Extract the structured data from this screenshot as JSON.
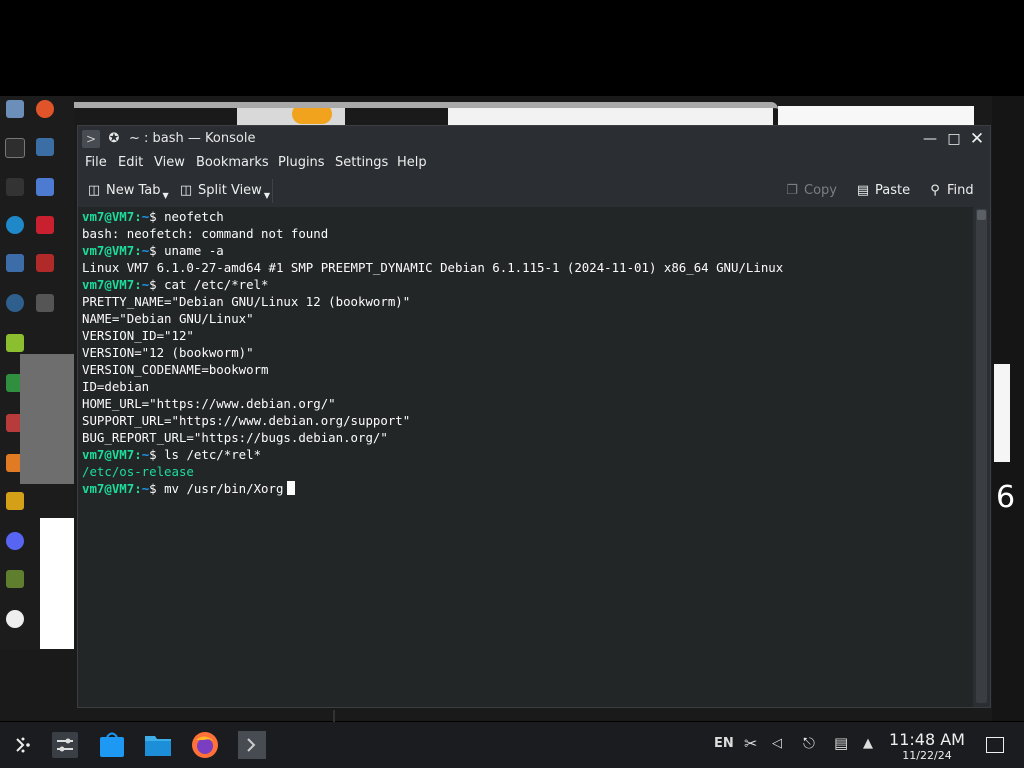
{
  "window": {
    "title": "~ : bash — Konsole",
    "app_icon": "terminal-icon",
    "controls": [
      "minimize",
      "maximize",
      "close"
    ]
  },
  "menu": [
    "File",
    "Edit",
    "View",
    "Bookmarks",
    "Plugins",
    "Settings",
    "Help"
  ],
  "toolbar": {
    "new_tab": "New Tab",
    "split_view": "Split View",
    "copy": "Copy",
    "paste": "Paste",
    "find": "Find"
  },
  "terminal": {
    "prompt_user": "vm7@VM7",
    "prompt_path": "~",
    "prompt_symbol": "$",
    "lines": [
      {
        "type": "cmd",
        "text": "neofetch"
      },
      {
        "type": "out",
        "text": "bash: neofetch: command not found"
      },
      {
        "type": "cmd",
        "text": "uname -a"
      },
      {
        "type": "out",
        "text": "Linux VM7 6.1.0-27-amd64 #1 SMP PREEMPT_DYNAMIC Debian 6.1.115-1 (2024-11-01) x86_64 GNU/Linux"
      },
      {
        "type": "cmd",
        "text": "cat /etc/*rel*"
      },
      {
        "type": "out",
        "text": "PRETTY_NAME=\"Debian GNU/Linux 12 (bookworm)\""
      },
      {
        "type": "out",
        "text": "NAME=\"Debian GNU/Linux\""
      },
      {
        "type": "out",
        "text": "VERSION_ID=\"12\""
      },
      {
        "type": "out",
        "text": "VERSION=\"12 (bookworm)\""
      },
      {
        "type": "out",
        "text": "VERSION_CODENAME=bookworm"
      },
      {
        "type": "out",
        "text": "ID=debian"
      },
      {
        "type": "out",
        "text": "HOME_URL=\"https://www.debian.org/\""
      },
      {
        "type": "out",
        "text": "SUPPORT_URL=\"https://www.debian.org/support\""
      },
      {
        "type": "out",
        "text": "BUG_REPORT_URL=\"https://bugs.debian.org/\""
      },
      {
        "type": "cmd",
        "text": "ls /etc/*rel*"
      },
      {
        "type": "file",
        "text": "/etc/os-release"
      },
      {
        "type": "cmd_active",
        "text": "mv /usr/bin/Xorg"
      }
    ]
  },
  "taskbar": {
    "apps": [
      "launcher-icon",
      "settings-icon",
      "store-icon",
      "files-icon",
      "firefox-icon",
      "terminal-icon"
    ],
    "language": "EN",
    "time": "11:48 AM",
    "date": "11/22/24"
  },
  "colors": {
    "prompt": "#1cdc9a",
    "path": "#1d99f3",
    "terminal_bg": "#232627",
    "window_chrome": "#2b2f33"
  }
}
